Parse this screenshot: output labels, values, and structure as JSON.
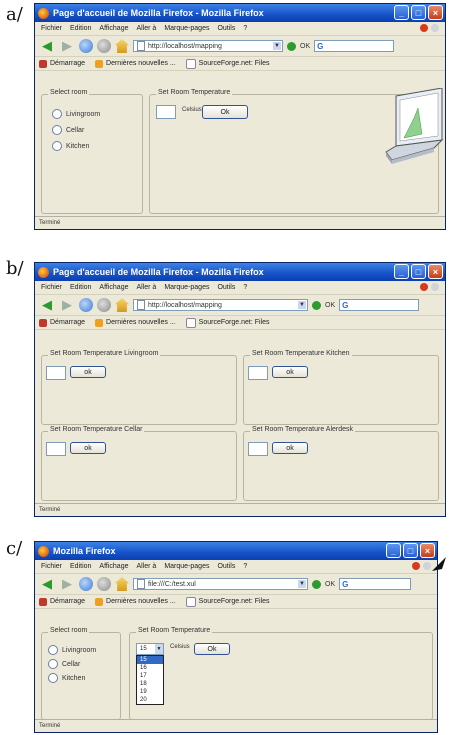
{
  "panels": [
    {
      "label": "a/",
      "window_title": "Page d'accueil de Mozilla Firefox - Mozilla Firefox",
      "menu": [
        "Fichier",
        "Edition",
        "Affichage",
        "Aller à",
        "Marque-pages",
        "Outils",
        "?"
      ],
      "url": "http://localhost/mapping",
      "ok_label": "OK",
      "bookmarks": [
        "Démarrage",
        "Dernières nouvelles ...",
        "SourceForge.net: Files"
      ],
      "select_room": {
        "legend": "Select room",
        "options": [
          "Livingroom",
          "Cellar",
          "Kitchen"
        ]
      },
      "set_temp": {
        "legend": "Set Room Temperature",
        "unit": "Celsius",
        "button": "Ok"
      },
      "status": "Terminé"
    },
    {
      "label": "b/",
      "window_title": "Page d'accueil de Mozilla Firefox - Mozilla Firefox",
      "menu": [
        "Fichier",
        "Edition",
        "Affichage",
        "Aller à",
        "Marque-pages",
        "Outils",
        "?"
      ],
      "url": "http://localhost/mapping",
      "ok_label": "OK",
      "bookmarks": [
        "Démarrage",
        "Dernières nouvelles ...",
        "SourceForge.net: Files"
      ],
      "groups": [
        {
          "legend": "Set Room Temperature Livingroom",
          "button": "ok"
        },
        {
          "legend": "Set Room Temperature Kitchen",
          "button": "ok"
        },
        {
          "legend": "Set Room Temperature Cellar",
          "button": "ok"
        },
        {
          "legend": "Set Room Temperature Alerdesk",
          "button": "ok"
        }
      ],
      "status": "Terminé"
    },
    {
      "label": "c/",
      "window_title": "Mozilla Firefox",
      "menu": [
        "Fichier",
        "Edition",
        "Affichage",
        "Aller à",
        "Marque-pages",
        "Outils",
        "?"
      ],
      "url": "file:///C:/test.xul",
      "ok_label": "OK",
      "bookmarks": [
        "Démarrage",
        "Dernières nouvelles ...",
        "SourceForge.net: Files"
      ],
      "select_room": {
        "legend": "Select room",
        "options": [
          "Livingroom",
          "Cellar",
          "Kitchen"
        ]
      },
      "set_temp": {
        "legend": "Set Room Temperature",
        "unit": "Celsius",
        "button": "Ok",
        "selected": "15"
      },
      "dropdown_options": [
        "15",
        "16",
        "17",
        "18",
        "19",
        "20"
      ],
      "status": "Terminé"
    }
  ],
  "colors": {
    "titlebar": "#1552c8",
    "dialog_bg": "#ece9d8",
    "selection": "#316ac5"
  }
}
